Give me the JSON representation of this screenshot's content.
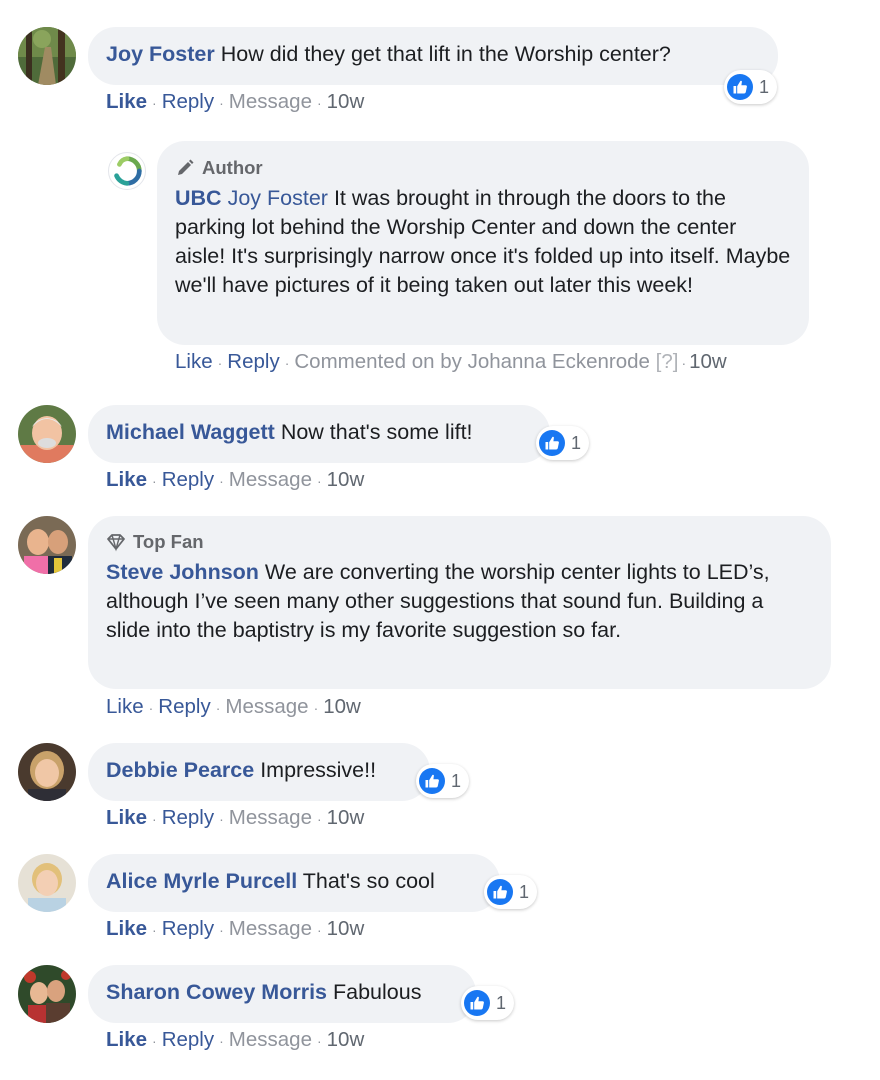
{
  "actions": {
    "like": "Like",
    "reply": "Reply",
    "message": "Message",
    "sep": "·"
  },
  "comments": [
    {
      "author": "Joy Foster",
      "text": "How did they get that lift in the Worship center?",
      "reactions": "1",
      "time": "10w"
    },
    {
      "badge": "Author",
      "author": "UBC",
      "mention": "Joy Foster",
      "text": "It was brought in through the doors to the parking lot behind the Worship Center and down the center aisle! It's surprisingly narrow once it's folded up into itself. Maybe we'll have pictures of it being taken out later this week!",
      "commented_on": "Commented on by Johanna Eckenrode",
      "help": "[?]",
      "time": "10w"
    },
    {
      "author": "Michael Waggett",
      "text": "Now that's some lift!",
      "reactions": "1",
      "time": "10w"
    },
    {
      "badge": "Top Fan",
      "author": "Steve Johnson",
      "text": "We are converting the worship center lights to LED’s, although I’ve seen many other suggestions that sound fun. Building a slide into the baptistry is my favorite suggestion so far.",
      "time": "10w"
    },
    {
      "author": "Debbie Pearce",
      "text": "Impressive!!",
      "reactions": "1",
      "time": "10w"
    },
    {
      "author": "Alice Myrle Purcell",
      "text": "That's so cool",
      "reactions": "1",
      "time": "10w"
    },
    {
      "author": "Sharon Cowey Morris",
      "text": "Fabulous",
      "reactions": "1",
      "time": "10w"
    }
  ],
  "colors": {
    "link": "#385898",
    "bubble": "#f0f2f5",
    "like": "#1877f2",
    "meta": "#90949c"
  },
  "icons": [
    "like-icon",
    "pencil-icon",
    "diamond-icon"
  ]
}
